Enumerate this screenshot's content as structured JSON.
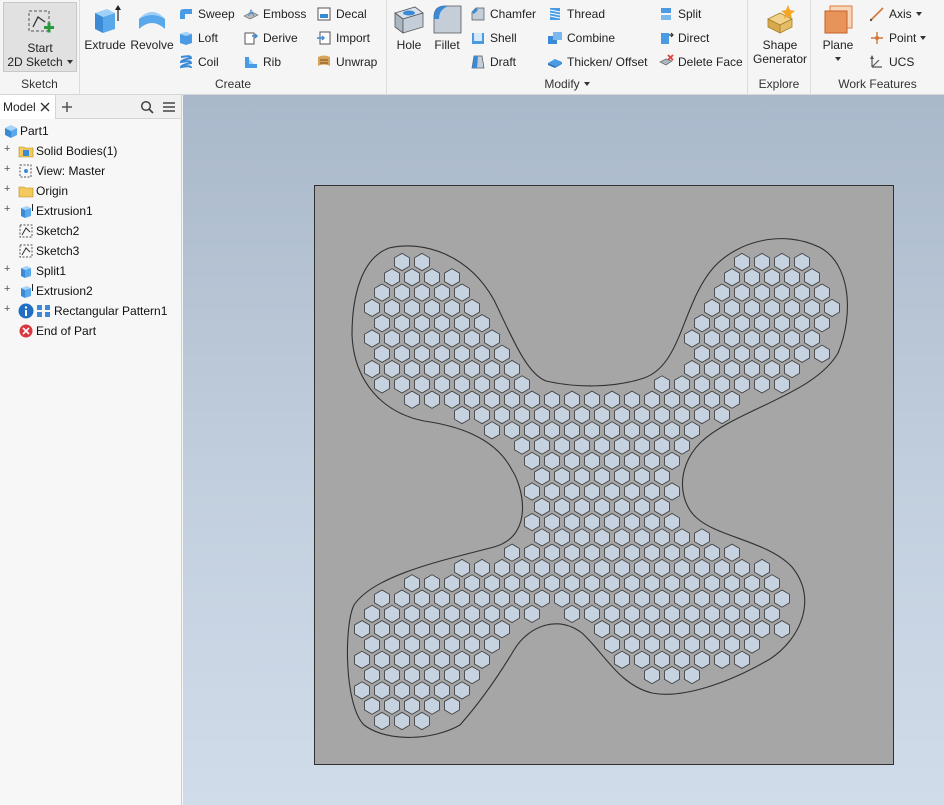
{
  "ribbon": {
    "sketch": {
      "title": "Sketch",
      "start_label_1": "Start",
      "start_label_2": "2D Sketch"
    },
    "create": {
      "title": "Create",
      "extrude": "Extrude",
      "revolve": "Revolve",
      "sweep": "Sweep",
      "loft": "Loft",
      "coil": "Coil",
      "emboss": "Emboss",
      "derive": "Derive",
      "rib": "Rib",
      "decal": "Decal",
      "import": "Import",
      "unwrap": "Unwrap"
    },
    "modify": {
      "title": "Modify",
      "hole": "Hole",
      "fillet": "Fillet",
      "chamfer": "Chamfer",
      "shell": "Shell",
      "draft": "Draft",
      "thread": "Thread",
      "combine": "Combine",
      "thicken": "Thicken/ Offset",
      "split": "Split",
      "direct": "Direct",
      "delete_face": "Delete Face"
    },
    "explore": {
      "title": "Explore",
      "shape_gen_1": "Shape",
      "shape_gen_2": "Generator"
    },
    "work_features": {
      "title": "Work Features",
      "plane": "Plane",
      "axis": "Axis",
      "point": "Point",
      "ucs": "UCS"
    }
  },
  "browser": {
    "tab_label": "Model",
    "tree": [
      {
        "label": "Part1",
        "icon": "part-icon",
        "expandable": false
      },
      {
        "label": "Solid Bodies(1)",
        "icon": "solid-bodies-folder-icon",
        "expandable": true
      },
      {
        "label": "View: Master",
        "icon": "view-icon",
        "expandable": true
      },
      {
        "label": "Origin",
        "icon": "folder-icon",
        "expandable": true
      },
      {
        "label": "Extrusion1",
        "icon": "extrusion-icon",
        "expandable": true
      },
      {
        "label": "Sketch2",
        "icon": "sketch-icon",
        "expandable": false
      },
      {
        "label": "Sketch3",
        "icon": "sketch-icon",
        "expandable": false
      },
      {
        "label": "Split1",
        "icon": "split-icon",
        "expandable": true
      },
      {
        "label": "Extrusion2",
        "icon": "extrusion-icon",
        "expandable": true
      },
      {
        "label": "Rectangular Pattern1",
        "icon": "rect-pattern-icon",
        "expandable": true
      },
      {
        "label": "End of Part",
        "icon": "end-of-part-icon",
        "expandable": false
      }
    ]
  },
  "colors": {
    "accent_blue": "#3b8ad6",
    "plate": "#a6a6a6",
    "hole_fill": "#c6d2e0",
    "error_red": "#e04040"
  }
}
